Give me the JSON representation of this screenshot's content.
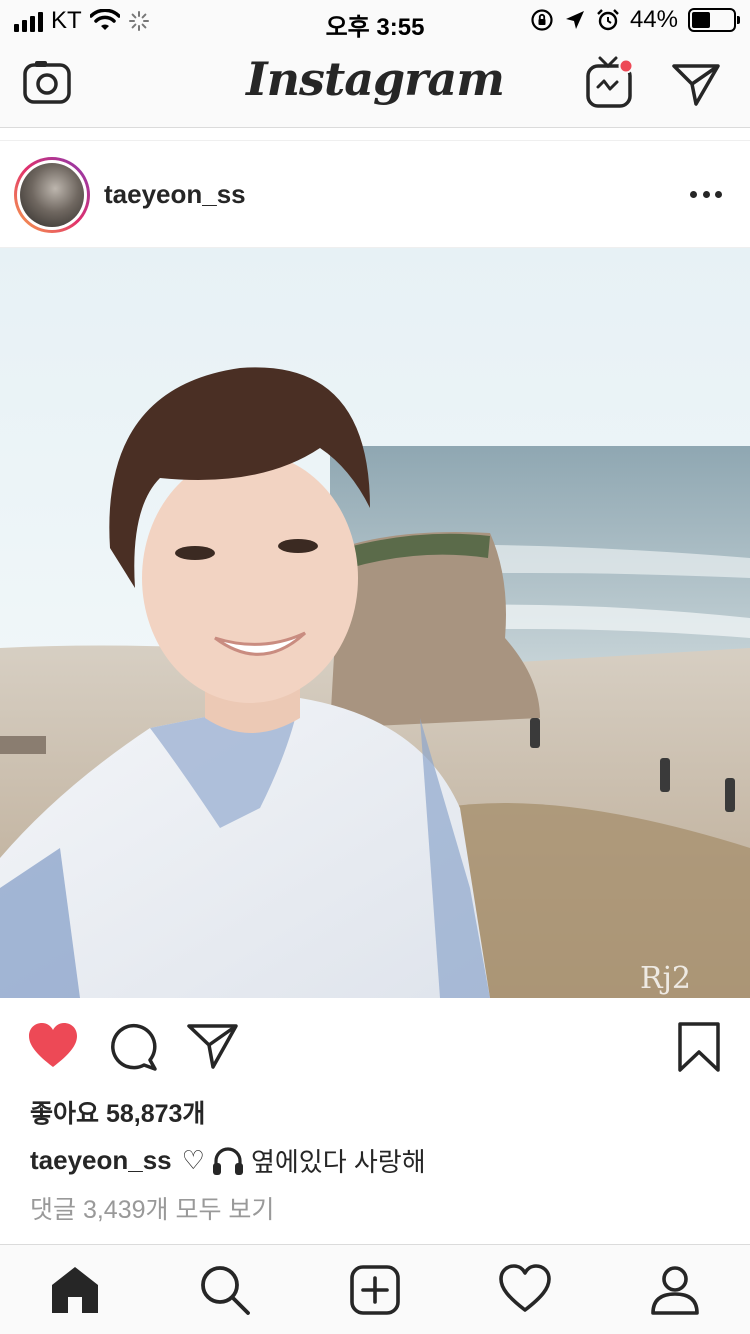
{
  "status_bar": {
    "carrier": "KT",
    "time": "오후 3:55",
    "battery_text": "44%",
    "battery_level": 0.44
  },
  "top_nav": {
    "logo_text": "Instagram"
  },
  "post": {
    "username": "taeyeon_ss",
    "image_alt_text": "",
    "likes_text": "좋아요 58,873개",
    "caption_user": "taeyeon_ss",
    "caption_emoji_heart": "♡",
    "caption_text": "옆에있다 사랑해",
    "comments_text": "댓글 3,439개 모두 보기",
    "liked": true
  },
  "tabs": [
    "home",
    "search",
    "new-post",
    "activity",
    "profile"
  ],
  "colors": {
    "like_red": "#ed4956",
    "text_dark": "#262626",
    "text_muted": "#999999",
    "divider": "#dbdbdb"
  }
}
